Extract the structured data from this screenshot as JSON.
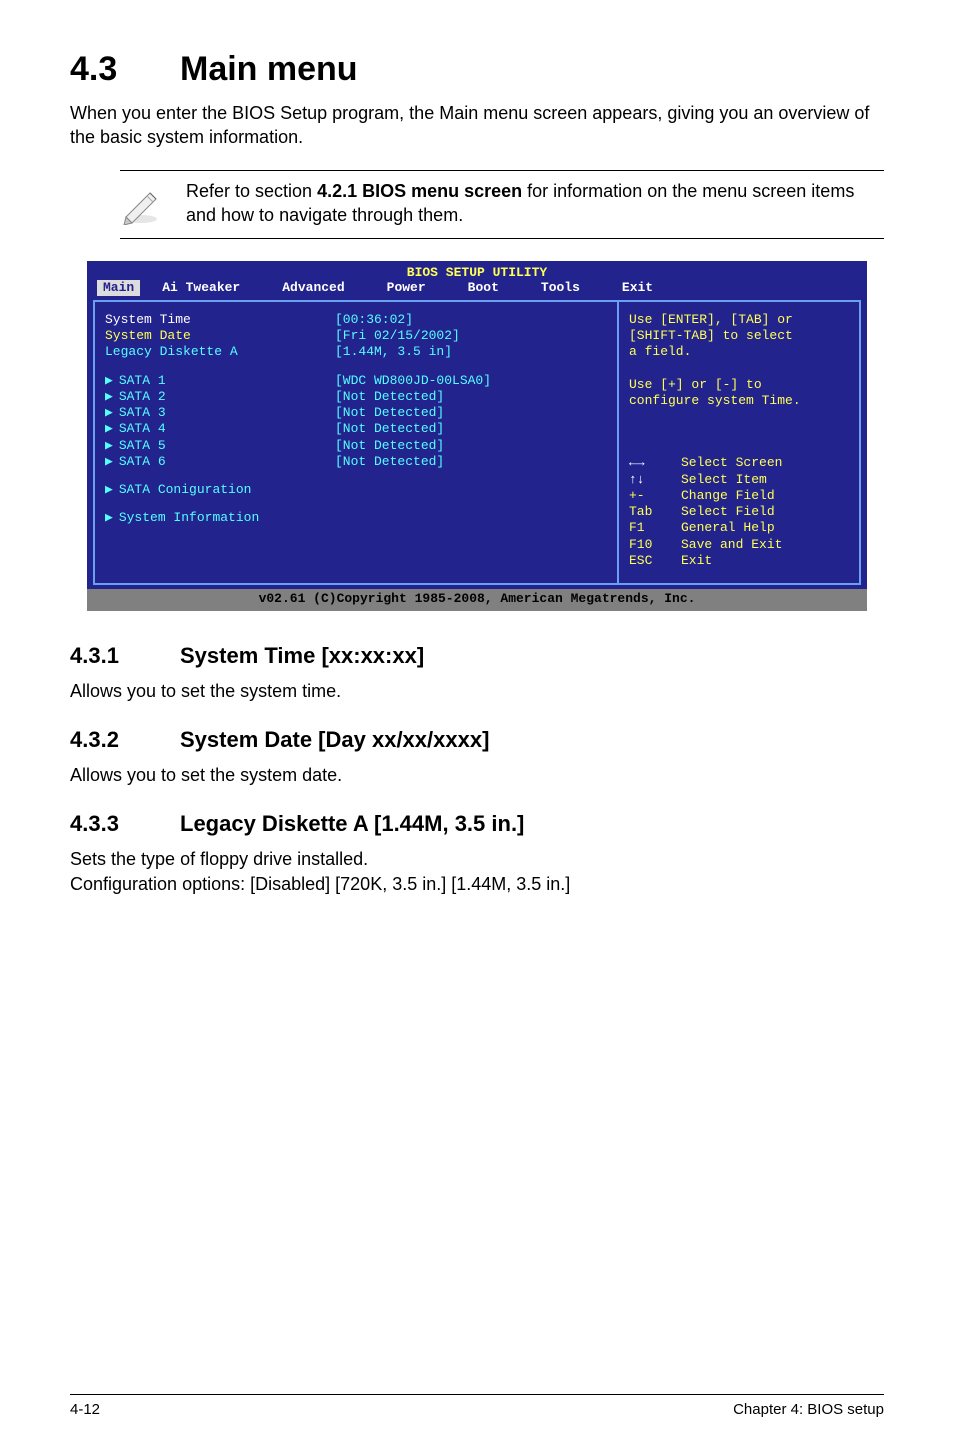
{
  "section": {
    "number": "4.3",
    "title": "Main menu"
  },
  "intro": "When you enter the BIOS Setup program, the Main menu screen appears, giving you an overview of the basic system information.",
  "note": {
    "text_a": "Refer to section ",
    "bold": "4.2.1  BIOS menu screen",
    "text_b": " for information on the menu screen items and how to navigate through them."
  },
  "bios": {
    "utility_title": "BIOS SETUP UTILITY",
    "menubar": [
      "Main",
      "Ai Tweaker",
      "Advanced",
      "Power",
      "Boot",
      "Tools",
      "Exit"
    ],
    "rows": [
      {
        "label": "System Time",
        "value": "[00:36:02]",
        "label_class": "white",
        "value_class": "cyan"
      },
      {
        "label": "System Date",
        "value": "[Fri 02/15/2002]",
        "label_class": "yellow",
        "value_class": "cyan"
      },
      {
        "label": "Legacy Diskette A",
        "value": "[1.44M, 3.5 in]",
        "label_class": "cyan",
        "value_class": "cyan"
      }
    ],
    "sata": [
      {
        "label": "SATA 1",
        "value": "[WDC WD800JD-00LSA0]"
      },
      {
        "label": "SATA 2",
        "value": "[Not Detected]"
      },
      {
        "label": "SATA 3",
        "value": "[Not Detected]"
      },
      {
        "label": "SATA 4",
        "value": "[Not Detected]"
      },
      {
        "label": "SATA 5",
        "value": "[Not Detected]"
      },
      {
        "label": "SATA 6",
        "value": "[Not Detected]"
      }
    ],
    "extras": [
      {
        "label": "SATA Coniguration"
      },
      {
        "label": "System Information"
      }
    ],
    "help_top": [
      "Use [ENTER], [TAB] or",
      "[SHIFT-TAB] to select",
      "a field.",
      "",
      "Use [+] or [-] to",
      "configure system Time."
    ],
    "help_legend": [
      {
        "key": "←→",
        "desc": "Select Screen"
      },
      {
        "key": "↑↓",
        "desc": "Select Item"
      },
      {
        "key": "+-",
        "desc": "Change Field"
      },
      {
        "key": "Tab",
        "desc": "Select Field"
      },
      {
        "key": "F1",
        "desc": "General Help"
      },
      {
        "key": "F10",
        "desc": "Save and Exit"
      },
      {
        "key": "ESC",
        "desc": "Exit"
      }
    ],
    "footer": "v02.61 (C)Copyright 1985-2008, American Megatrends, Inc."
  },
  "subs": [
    {
      "num": "4.3.1",
      "title": "System Time [xx:xx:xx]",
      "body": "Allows you to set the system time."
    },
    {
      "num": "4.3.2",
      "title": "System Date [Day xx/xx/xxxx]",
      "body": "Allows you to set the system date."
    },
    {
      "num": "4.3.3",
      "title": "Legacy Diskette A [1.44M, 3.5 in.]",
      "body": "Sets the type of floppy drive installed.",
      "body2": "Configuration options: [Disabled] [720K, 3.5 in.] [1.44M, 3.5 in.]"
    }
  ],
  "footer": {
    "left": "4-12",
    "right": "Chapter 4: BIOS setup"
  }
}
